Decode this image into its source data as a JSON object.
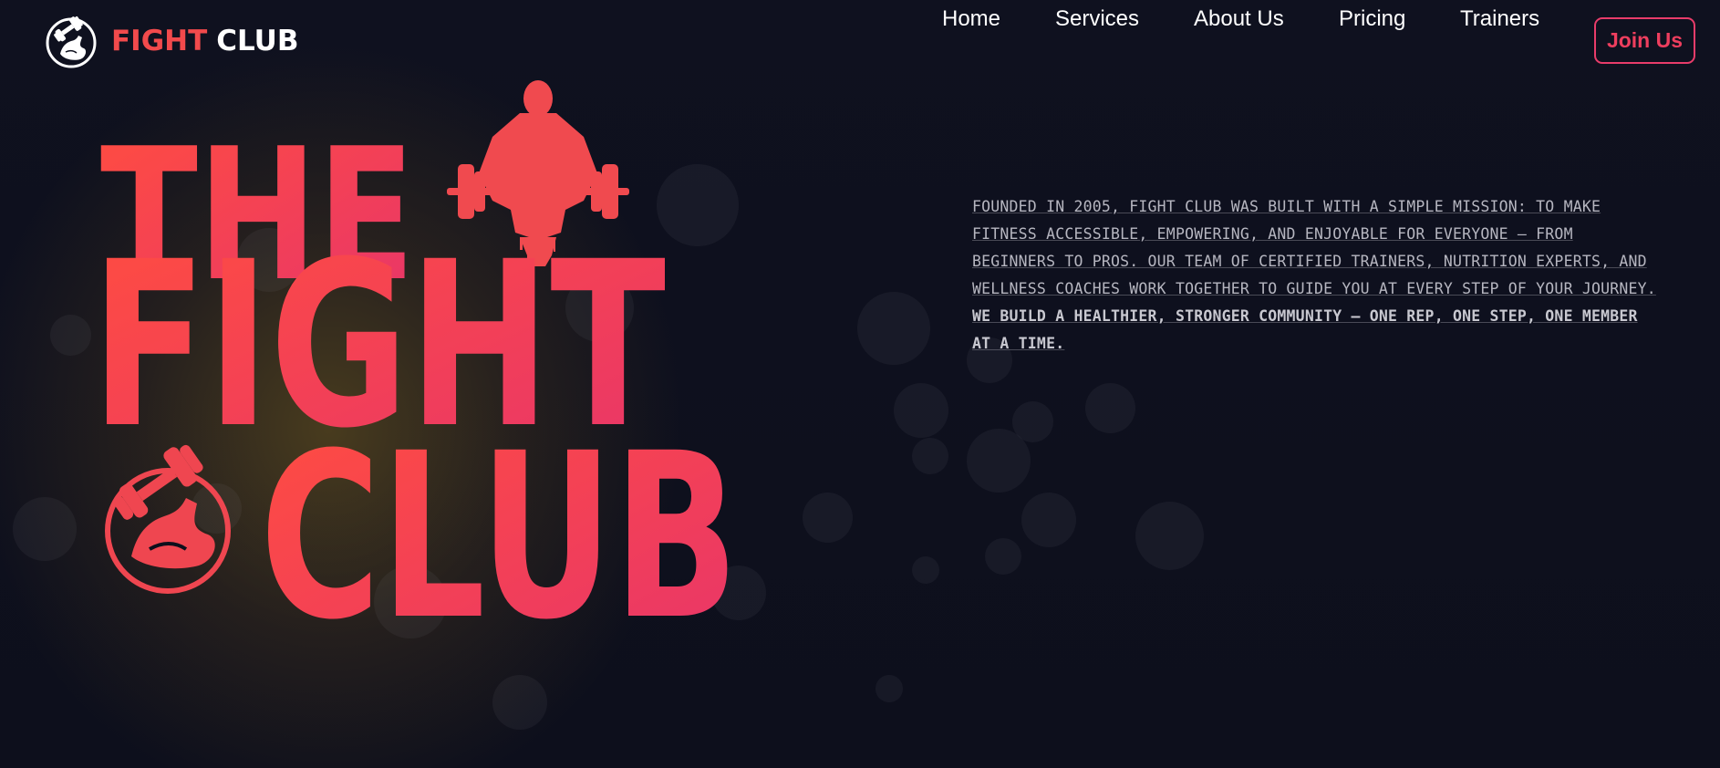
{
  "brand": {
    "name_part1": "FIGHT",
    "name_part2": "CLUB",
    "icon": "flexing-arm-dumbbell-icon"
  },
  "nav": {
    "items": [
      {
        "label": "Home"
      },
      {
        "label": "Services"
      },
      {
        "label": "About Us"
      },
      {
        "label": "Pricing"
      },
      {
        "label": "Trainers"
      }
    ],
    "cta_label": "Join Us"
  },
  "hero": {
    "line1": "THE",
    "line2": "FIGHT",
    "line3": "CLUB",
    "silhouette_icon": "bodybuilder-barbell-silhouette-icon",
    "emblem_icon": "flexing-arm-dumbbell-icon"
  },
  "about": {
    "paragraph1": "Founded in 2005, Fight Club was built with a simple mission: to make fitness accessible, empowering, and enjoyable for everyone — from beginners to pros. Our team of certified trainers, nutrition experts, and wellness coaches work together to guide you at every step of your journey.",
    "paragraph2": "We build a healthier, stronger community — one rep, one step, one member at a time."
  },
  "colors": {
    "background": "#0d0f1c",
    "accent_red": "#f24a4c",
    "accent_pink": "#e83c6a",
    "text_light": "#ffffff",
    "text_muted": "#b6b6c0"
  }
}
